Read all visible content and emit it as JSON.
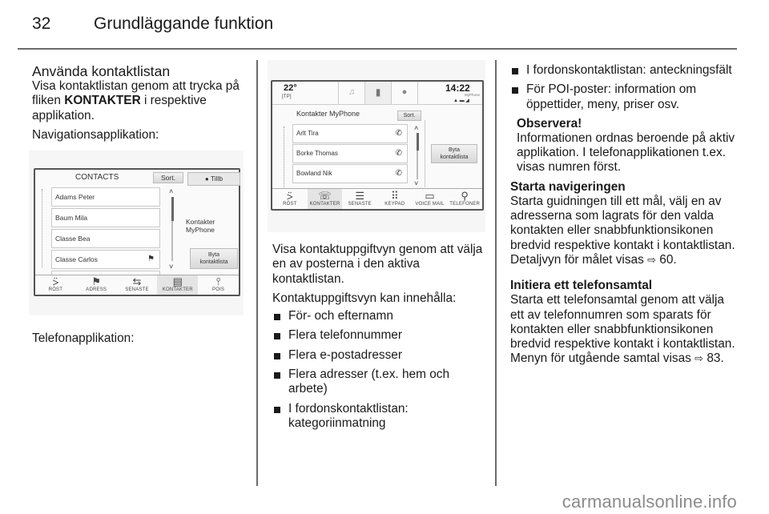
{
  "page": {
    "number": "32",
    "chapter": "Grundläggande funktion",
    "watermark": "carmanualsonline.info"
  },
  "left_column": {
    "heading": "Använda kontaktlistan",
    "intro_pre": "Visa kontaktlistan genom att trycka på fliken ",
    "intro_bold": "KONTAKTER",
    "intro_post": " i respektive applikation.",
    "nav_label": "Navigationsapplikation:",
    "phone_label": "Telefonapplikation:"
  },
  "nav_screen": {
    "title": "CONTACTS",
    "sort_button": "Sort.",
    "add_button": "Tillb",
    "contacts": [
      "Adams Peter",
      "Baum Mila",
      "Classe Bea",
      "Classe Carlos"
    ],
    "source_label": "Kontakter MyPhone",
    "switch_button_line1": "Byta",
    "switch_button_line2": "kontaktlista",
    "tabs": [
      {
        "label": "RÖST",
        "icon": "voice-icon"
      },
      {
        "label": "ADRESS",
        "icon": "flag-icon"
      },
      {
        "label": "SENASTE",
        "icon": "recent-icon"
      },
      {
        "label": "KONTAKTER",
        "icon": "contacts-icon",
        "active": true
      },
      {
        "label": "POIS",
        "icon": "poi-icon"
      }
    ]
  },
  "phone_screen": {
    "temperature": "22°",
    "tp_label": "[TP]",
    "time": "14:22",
    "device": "MyPhone",
    "list_title": "Kontakter MyPhone",
    "sort_button": "Sort.",
    "contacts": [
      "Arlt Tira",
      "Borke Thomas",
      "Bowland Nik"
    ],
    "switch_button_line1": "Byta",
    "switch_button_line2": "kontaktlista",
    "tabs": [
      {
        "label": "RÖST",
        "icon": "voice-icon"
      },
      {
        "label": "KONTAKTER",
        "icon": "contacts-icon",
        "active": true
      },
      {
        "label": "SENASTE",
        "icon": "recent-calls-icon"
      },
      {
        "label": "KEYPAD",
        "icon": "keypad-icon"
      },
      {
        "label": "VOICE MAIL",
        "icon": "voicemail-icon"
      },
      {
        "label": "TELEFONER",
        "icon": "phones-icon"
      }
    ]
  },
  "middle_column": {
    "para1": "Visa kontaktuppgiftvyn genom att välja en av posterna i den aktiva kontaktlistan.",
    "para2": "Kontaktuppgiftsvyn kan innehålla:",
    "bullets": [
      "För- och efternamn",
      "Flera telefonnummer",
      "Flera e-postadresser",
      "Flera adresser (t.ex. hem och arbete)",
      "I fordonskontaktlistan: kategoriinmatning"
    ]
  },
  "right_column": {
    "bullets": [
      "I fordonskontaktlistan: anteckningsfält",
      "För POI-poster: information om öppettider, meny, priser osv."
    ],
    "note_title": "Observera!",
    "note_text": "Informationen ordnas beroende på aktiv applikation. I telefonapplikationen t.ex. visas numren först.",
    "nav_heading": "Starta navigeringen",
    "nav_text": "Starta guidningen till ett mål, välj en av adresserna som lagrats för den valda kontakten eller snabbfunktionsikonen bredvid respektive kontakt i kontaktlistan. Detaljvyn för målet visas",
    "nav_ref_icon": "⇨",
    "nav_ref": "60.",
    "call_heading": "Initiera ett telefonsamtal",
    "call_text": "Starta ett telefonsamtal genom att välja ett av telefonnumren som sparats för kontakten eller snabbfunktionsikonen bredvid respektive kontakt i kontaktlistan. Menyn för utgående samtal visas",
    "call_ref_icon": "⇨",
    "call_ref": "83."
  }
}
